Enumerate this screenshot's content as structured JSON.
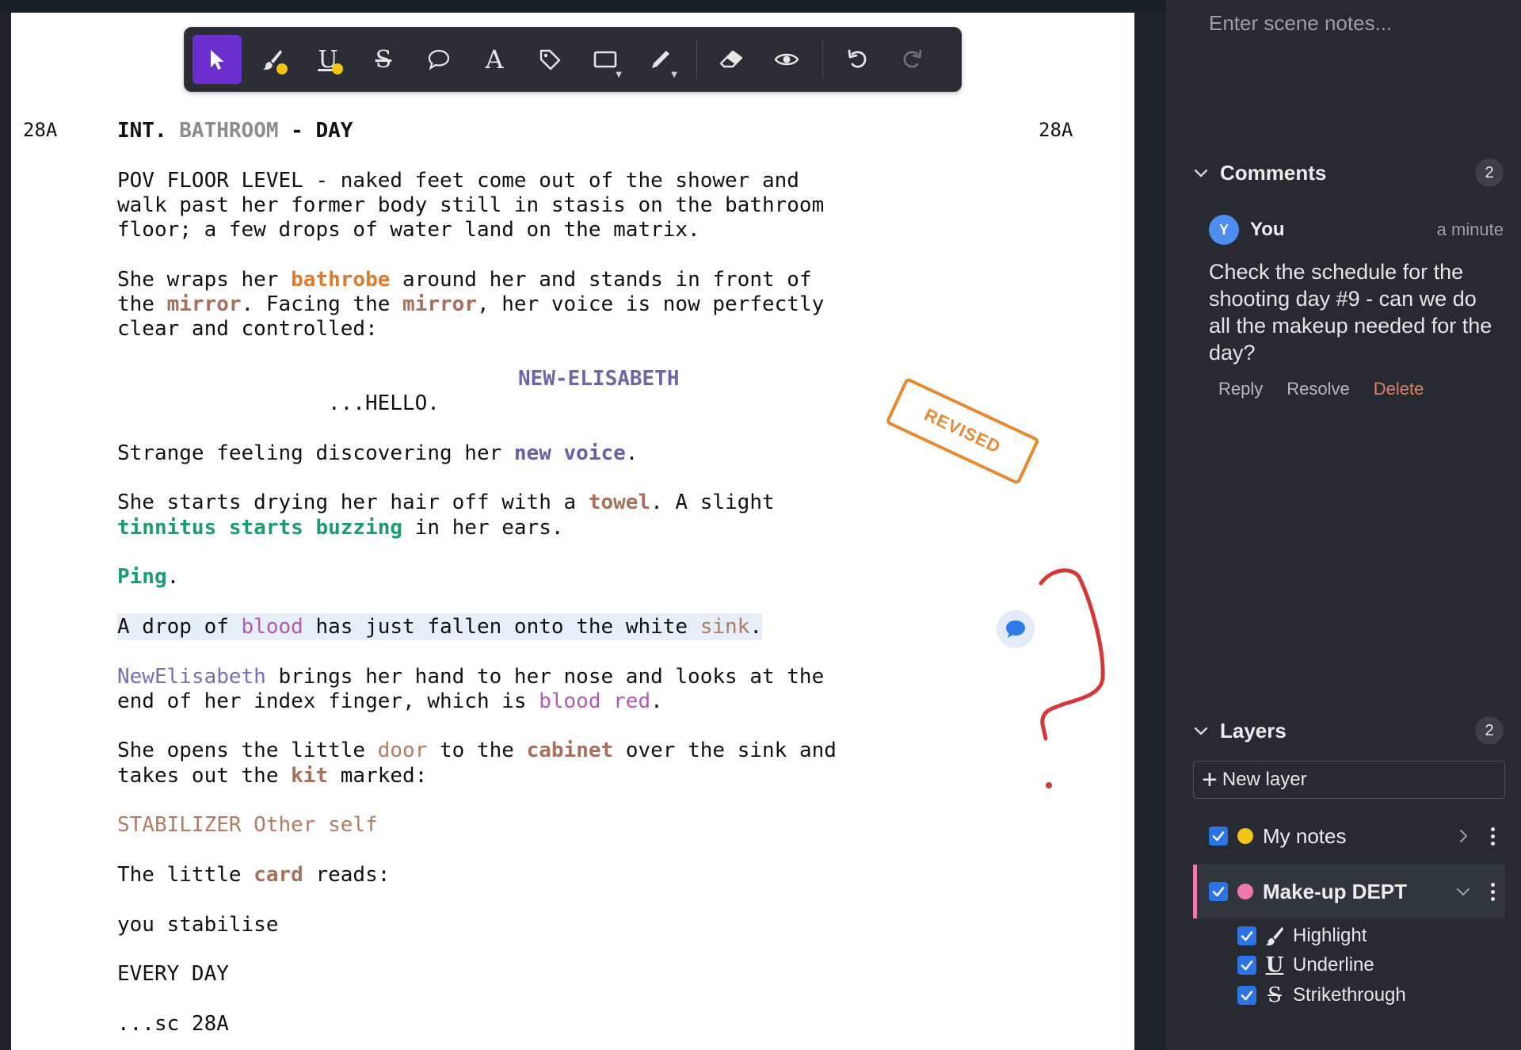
{
  "toolbar": {
    "tools": [
      {
        "name": "select",
        "icon": "cursor-arrow-icon",
        "active": true
      },
      {
        "name": "highlight",
        "icon": "brush-icon",
        "dot_color": "#f2c518"
      },
      {
        "name": "underline",
        "icon": "underline-icon",
        "glyph": "U",
        "dot_color": "#f2c518"
      },
      {
        "name": "strikethrough",
        "icon": "strikethrough-icon",
        "glyph": "S"
      },
      {
        "name": "comment",
        "icon": "speech-bubble-icon"
      },
      {
        "name": "text",
        "icon": "text-icon",
        "glyph": "A"
      },
      {
        "name": "tag",
        "icon": "tag-icon"
      },
      {
        "name": "shape",
        "icon": "rectangle-icon",
        "has_dropdown": true
      },
      {
        "name": "pen",
        "icon": "pen-icon",
        "has_dropdown": true
      },
      {
        "name": "eraser",
        "icon": "eraser-icon"
      },
      {
        "name": "visibility",
        "icon": "eye-icon"
      },
      {
        "name": "undo",
        "icon": "undo-icon"
      },
      {
        "name": "redo",
        "icon": "redo-icon",
        "disabled": true
      }
    ]
  },
  "script": {
    "scene_number": "28A",
    "slug": {
      "int": "INT.",
      "location": "BATHROOM",
      "dash": " - ",
      "time": "DAY"
    },
    "p1": "POV FLOOR LEVEL - naked feet come out of the shower and\nwalk past her former body still in stasis on the bathroom\nfloor; a few drops of water land on the matrix.",
    "p2": {
      "a": "She wraps her ",
      "bathrobe": "bathrobe",
      "b": " around her and stands in front of\nthe ",
      "mirror1": "mirror",
      "c": ". Facing the ",
      "mirror2": "mirror",
      "d": ", her voice is now perfectly\nclear and controlled:"
    },
    "character": "NEW-ELISABETH",
    "dialogue": "...HELLO.",
    "p3": {
      "a": "Strange feeling discovering her ",
      "new_voice": "new voice",
      "b": "."
    },
    "p4": {
      "a": "She starts drying her hair off with a ",
      "towel": "towel",
      "b": ". A slight\n",
      "tinnitus": "tinnitus starts buzzing",
      "c": " in her ears."
    },
    "p5": {
      "ping": "Ping",
      "b": "."
    },
    "p6": {
      "a": "A drop of ",
      "blood": "blood",
      "b": " has just fallen onto the white ",
      "sink": "sink",
      "c": "."
    },
    "p7": {
      "name": "NewElisabeth",
      "a": " brings her hand to her nose and looks at the\nend of her index finger, which is ",
      "blood_red": "blood red",
      "b": "."
    },
    "p8": {
      "a": "She opens the little ",
      "door": "door",
      "b": " to the ",
      "cabinet": "cabinet",
      "c": " over the sink and\ntakes out the ",
      "kit": "kit",
      "d": " marked:"
    },
    "p9": "STABILIZER Other self",
    "p10": {
      "a": "The little ",
      "card": "card",
      "b": " reads:"
    },
    "p11": "you stabilise",
    "p12": "EVERY DAY",
    "p13": "...sc 28A"
  },
  "stamp": {
    "label": "REVISED",
    "color": "#e28a34"
  },
  "sidebar": {
    "scene_notes_placeholder": "Enter scene notes...",
    "comments": {
      "title": "Comments",
      "count": "2",
      "items": [
        {
          "avatar_letter": "Y",
          "author": "You",
          "time": "a minute",
          "body": "Check the schedule for the shooting day #9 - can we do all the makeup needed for the day?",
          "reply": "Reply",
          "resolve": "Resolve",
          "delete": "Delete"
        }
      ]
    },
    "layers": {
      "title": "Layers",
      "count": "2",
      "new_layer": "New layer",
      "items": [
        {
          "name": "My notes",
          "color": "#f2c518",
          "checked": true,
          "expanded": false
        },
        {
          "name": "Make-up DEPT",
          "color": "#f07ab0",
          "checked": true,
          "expanded": true,
          "selected": true
        }
      ],
      "sublayers": [
        {
          "name": "Highlight",
          "icon": "brush-icon",
          "checked": true
        },
        {
          "name": "Underline",
          "icon": "underline-icon",
          "checked": true
        },
        {
          "name": "Strikethrough",
          "icon": "strikethrough-icon",
          "checked": true
        }
      ]
    }
  },
  "colors": {
    "accent": "#6b2fd0",
    "checkbox": "#2c74e6",
    "ink": "#d23a3a"
  }
}
